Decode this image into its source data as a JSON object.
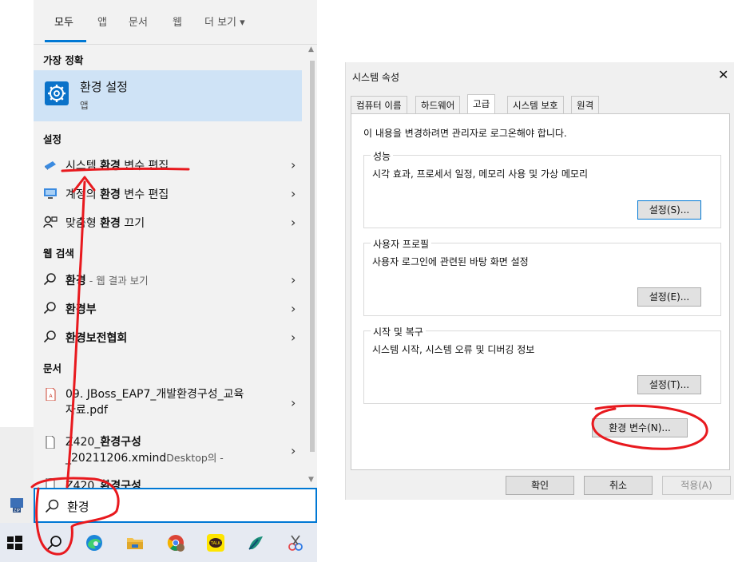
{
  "search": {
    "tabs": [
      "모두",
      "앱",
      "문서",
      "웹",
      "더 보기 ▾"
    ],
    "active_tab": 0,
    "sections": {
      "best_match": "가장 정확",
      "settings": "설정",
      "web": "웹 검색",
      "documents": "문서"
    },
    "best": {
      "title": "환경 설정",
      "subtitle": "앱"
    },
    "settings_items": [
      {
        "pre": "시스템 ",
        "hl": "환경",
        "post": " 변수 편집"
      },
      {
        "pre": "계정의 ",
        "hl": "환경",
        "post": " 변수 편집"
      },
      {
        "pre": "맞춤형 ",
        "hl": "환경",
        "post": " 끄기"
      }
    ],
    "web_items": [
      {
        "hl": "환경",
        "post": "",
        "dim": " - 웹 결과 보기"
      },
      {
        "hl": "환경",
        "post": "부",
        "dim": ""
      },
      {
        "hl": "환경",
        "post": "보전협회",
        "dim": ""
      }
    ],
    "doc_items": [
      {
        "line1": "09. JBoss_EAP7_개발환경구성_교육",
        "line2": "자료.pdf"
      },
      {
        "line1_pre": "Z420_",
        "line1_hl": "환경구성",
        "line2": "_20211206.xmind",
        "line2_dim": "Desktop의 -"
      },
      {
        "line1_pre": "Z420_",
        "line1_hl": "환경구성"
      }
    ],
    "query": "환경",
    "chevron": "›"
  },
  "dialog": {
    "title": "시스템 속성",
    "close": "✕",
    "tabs": [
      "컴퓨터 이름",
      "하드웨어",
      "고급",
      "시스템 보호",
      "원격"
    ],
    "active_tab": 2,
    "note": "이 내용을 변경하려면 관리자로 로그온해야 합니다.",
    "groups": [
      {
        "title": "성능",
        "desc": "시각 효과, 프로세서 일정, 메모리 사용 및 가상 메모리",
        "button": "설정(S)..."
      },
      {
        "title": "사용자 프로필",
        "desc": "사용자 로그인에 관련된 바탕 화면 설정",
        "button": "설정(E)..."
      },
      {
        "title": "시작 및 복구",
        "desc": "시스템 시작, 시스템 오류 및 디버깅 정보",
        "button": "설정(T)..."
      }
    ],
    "env_button": "환경 변수(N)...",
    "ok": "확인",
    "cancel": "취소",
    "apply": "적용(A)"
  },
  "colors": {
    "accent": "#0078d4",
    "highlight": "#cfe3f6",
    "annotation": "#e8191e"
  }
}
